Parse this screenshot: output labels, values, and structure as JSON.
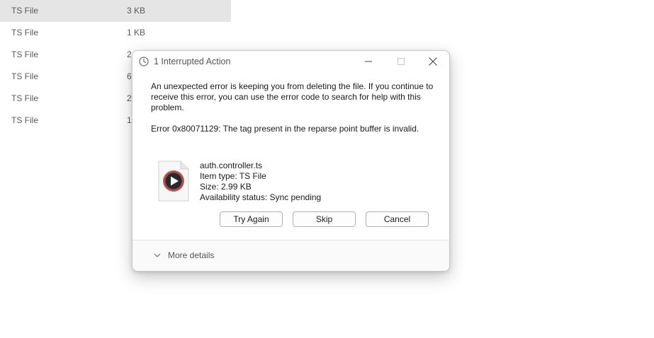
{
  "background_list": {
    "rows": [
      {
        "type": "TS File",
        "size": "3 KB",
        "selected": true
      },
      {
        "type": "TS File",
        "size": "1 KB",
        "selected": false
      },
      {
        "type": "TS File",
        "size": "2",
        "selected": false
      },
      {
        "type": "TS File",
        "size": "6",
        "selected": false
      },
      {
        "type": "TS File",
        "size": "2",
        "selected": false
      },
      {
        "type": "TS File",
        "size": "1",
        "selected": false
      }
    ]
  },
  "dialog": {
    "title": "1 Interrupted Action",
    "message": "An unexpected error is keeping you from deleting the file. If you continue to receive this error, you can use the error code to search for help with this problem.",
    "error_line": "Error 0x80071129: The tag present in the reparse point buffer is invalid.",
    "file": {
      "name": "auth.controller.ts",
      "item_type": "Item type: TS File",
      "size": "Size: 2.99 KB",
      "availability": "Availability status: Sync pending"
    },
    "buttons": {
      "try_again": "Try Again",
      "skip": "Skip",
      "cancel": "Cancel"
    },
    "more_details": "More details"
  },
  "colors": {
    "selected_row": "#e5e5e5",
    "dialog_border": "#c8c8c8",
    "button_border": "#b0b0b0"
  },
  "icons": {
    "title": "clock-icon",
    "minimize": "minimize-icon",
    "maximize": "maximize-icon",
    "close": "close-icon",
    "file": "media-file-icon",
    "expand": "chevron-down-icon"
  }
}
